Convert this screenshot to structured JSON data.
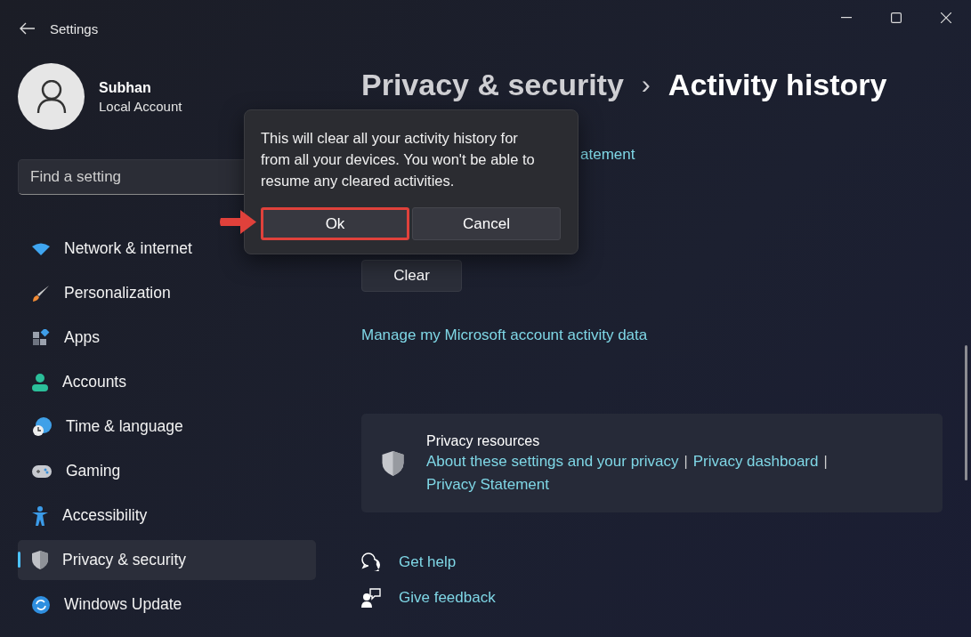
{
  "window": {
    "title": "Settings"
  },
  "user": {
    "name": "Subhan",
    "account_type": "Local Account"
  },
  "search": {
    "placeholder": "Find a setting"
  },
  "nav": [
    {
      "label": "Network & internet",
      "selected": false
    },
    {
      "label": "Personalization",
      "selected": false
    },
    {
      "label": "Apps",
      "selected": false
    },
    {
      "label": "Accounts",
      "selected": false
    },
    {
      "label": "Time & language",
      "selected": false
    },
    {
      "label": "Gaming",
      "selected": false
    },
    {
      "label": "Accessibility",
      "selected": false
    },
    {
      "label": "Privacy & security",
      "selected": true
    },
    {
      "label": "Windows Update",
      "selected": false
    }
  ],
  "breadcrumb": {
    "parent": "Privacy & security",
    "separator": "›",
    "current": "Activity history"
  },
  "content": {
    "partial_link": "atement",
    "clear_button": "Clear",
    "manage_link": "Manage my Microsoft account activity data"
  },
  "resources_card": {
    "title": "Privacy resources",
    "links": [
      {
        "kind": "link",
        "text": "About these settings and your privacy"
      },
      {
        "kind": "separator",
        "text": "|"
      },
      {
        "kind": "link",
        "text": "Privacy dashboard"
      },
      {
        "kind": "separator",
        "text": "|"
      },
      {
        "kind": "link",
        "text": "Privacy Statement"
      }
    ]
  },
  "footer_links": [
    "Get help",
    "Give feedback"
  ],
  "dialog": {
    "message": "This will clear all your activity history for from all your devices. You won't be able to resume any cleared activities.",
    "buttons": [
      {
        "label": "Ok",
        "highlighted": true
      },
      {
        "label": "Cancel",
        "highlighted": false
      }
    ]
  }
}
